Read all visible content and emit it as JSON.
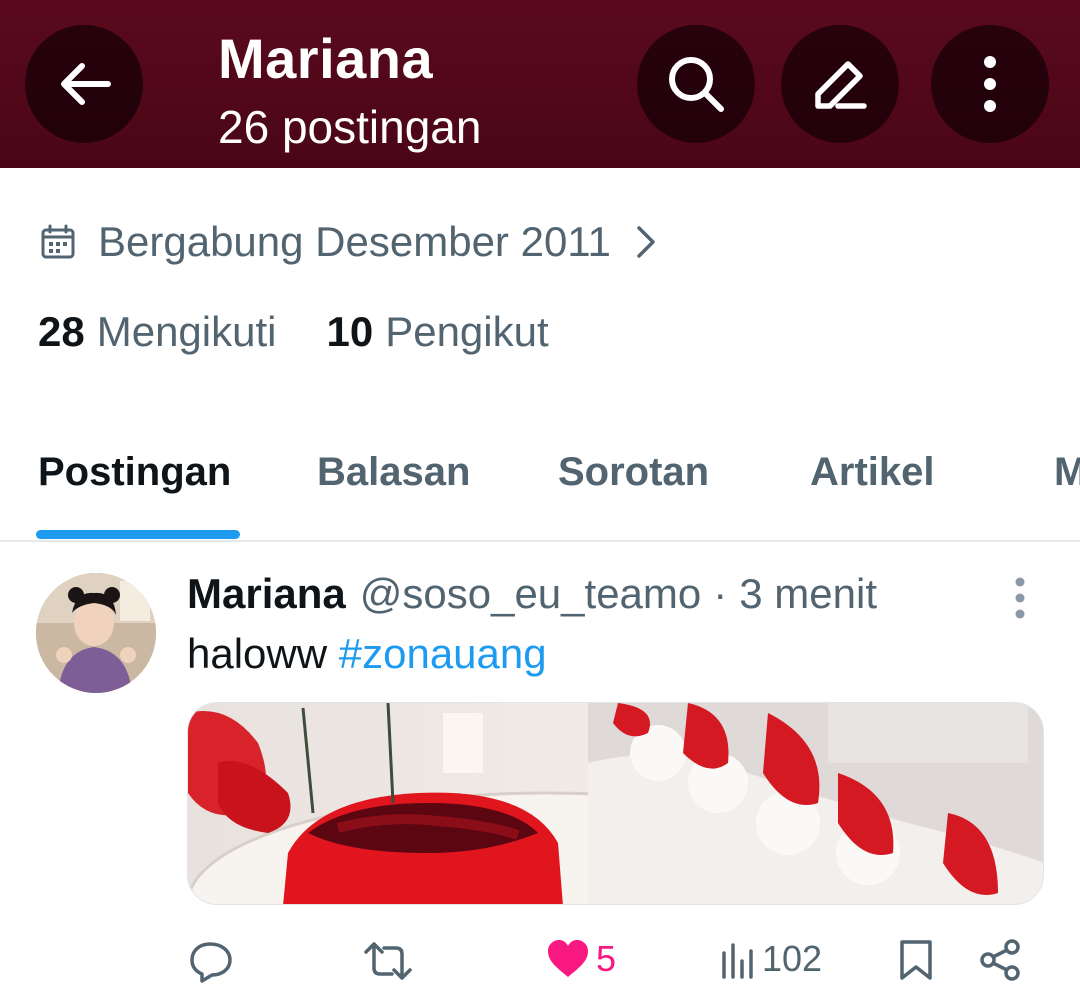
{
  "header": {
    "title": "Mariana",
    "subtitle": "26 postingan"
  },
  "icons": {
    "back": "arrow-left-icon",
    "search": "search-icon",
    "edit": "pencil-icon",
    "more": "more-vertical-icon"
  },
  "profile": {
    "joined_label": "Bergabung Desember 2011",
    "following_count": "28",
    "following_label": "Mengikuti",
    "followers_count": "10",
    "followers_label": "Pengikut"
  },
  "tabs": [
    {
      "label": "Postingan",
      "active": true
    },
    {
      "label": "Balasan",
      "active": false
    },
    {
      "label": "Sorotan",
      "active": false
    },
    {
      "label": "Artikel",
      "active": false
    },
    {
      "label": "M",
      "active": false
    }
  ],
  "post": {
    "author_name": "Mariana",
    "author_handle": "@soso_eu_teamo",
    "separator": "·",
    "time": "3 menit",
    "text": "haloww",
    "hashtag": "#zonauang",
    "likes": "5",
    "views": "102"
  },
  "colors": {
    "header_bg": "#5a0a1e",
    "accent": "#1d9bf0",
    "like": "#f91880",
    "muted": "#536471"
  }
}
